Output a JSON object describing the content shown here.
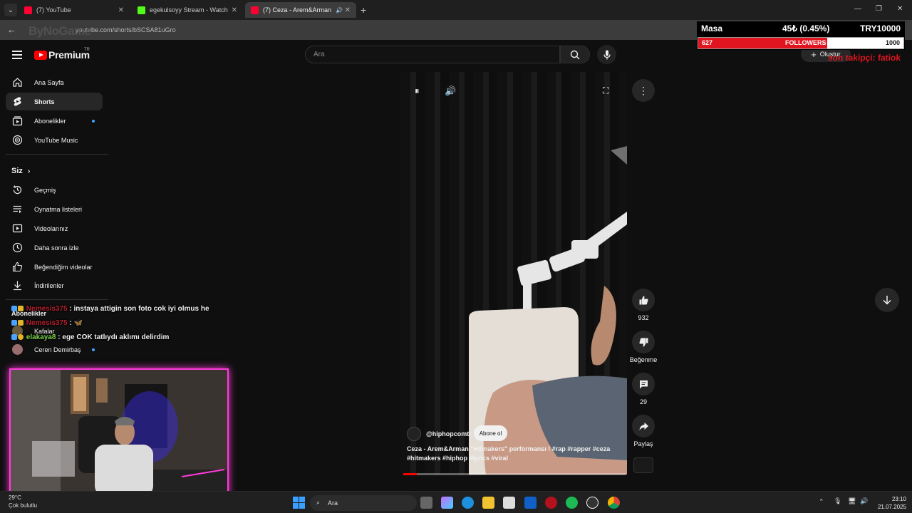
{
  "tabs": [
    {
      "title": "(7) YouTube"
    },
    {
      "title": "egekulsoyy Stream - Watch Live"
    },
    {
      "title": "(7) Ceza - Arem&Arman \"Hitmakers\""
    }
  ],
  "address": {
    "url": "youtube.com/shorts/bSCSA81uGro"
  },
  "overlay_logo": "ByNoGame",
  "youtube": {
    "logo_text": "Premium",
    "region": "TR",
    "search_placeholder": "Ara",
    "create_label": "Oluştur",
    "notification_count": "7"
  },
  "sidebar": {
    "main": [
      {
        "label": "Ana Sayfa",
        "icon": "home-icon"
      },
      {
        "label": "Shorts",
        "icon": "shorts-icon",
        "active": true
      },
      {
        "label": "Abonelikler",
        "icon": "subscriptions-icon",
        "dot": true
      },
      {
        "label": "YouTube Music",
        "icon": "music-icon"
      }
    ],
    "you_heading": "Siz",
    "you": [
      {
        "label": "Geçmiş",
        "icon": "history-icon"
      },
      {
        "label": "Oynatma listeleri",
        "icon": "playlist-icon"
      },
      {
        "label": "Videolarınız",
        "icon": "your-videos-icon"
      },
      {
        "label": "Daha sonra izle",
        "icon": "watch-later-icon"
      },
      {
        "label": "Beğendiğim videolar",
        "icon": "liked-icon"
      },
      {
        "label": "İndirilenler",
        "icon": "download-icon"
      }
    ],
    "subs_heading": "Abonelikler",
    "subs": [
      {
        "label": "Kafalar"
      },
      {
        "label": "Ceren Demirbaş"
      }
    ]
  },
  "chat": [
    {
      "user": "Nemesis375",
      "message": ": instaya attigin son foto cok iyi olmus he"
    },
    {
      "user": "Nemesis375",
      "message": ": 🦋"
    },
    {
      "user": "elakaya8",
      "message": ": ege COK tatlıydı aklımı delirdim"
    }
  ],
  "player": {
    "channel": "@hiphopcomtr",
    "subscribe_label": "Abone ol",
    "caption": "Ceza - Arem&Arman \"Hitmakers\" performansı ! #rap #rapper #ceza #hitmakers #hiphop #lyrics #viral",
    "progress_fraction": 0.06
  },
  "actions": {
    "like_count": "932",
    "dislike_label": "Beğenme",
    "comment_count": "29",
    "share_label": "Paylaş"
  },
  "widget": {
    "label": "Masa",
    "change": "45₺ (0.45%)",
    "goal": "TRY10000",
    "followers_current": "627",
    "followers_label": "FOLLOWERS",
    "followers_goal": "1000",
    "followers_fraction": 0.627,
    "last_follower": "son takipçi: fatiok"
  },
  "taskbar": {
    "weather_temp": "29°C",
    "weather_desc": "Çok bulutlu",
    "search_placeholder": "Ara",
    "time": "23:10",
    "date": "21.07.2025"
  },
  "colors": {
    "accent_red": "#ff0000",
    "stream_frame": "#ff3bd9",
    "link_blue": "#3ea6ff"
  }
}
